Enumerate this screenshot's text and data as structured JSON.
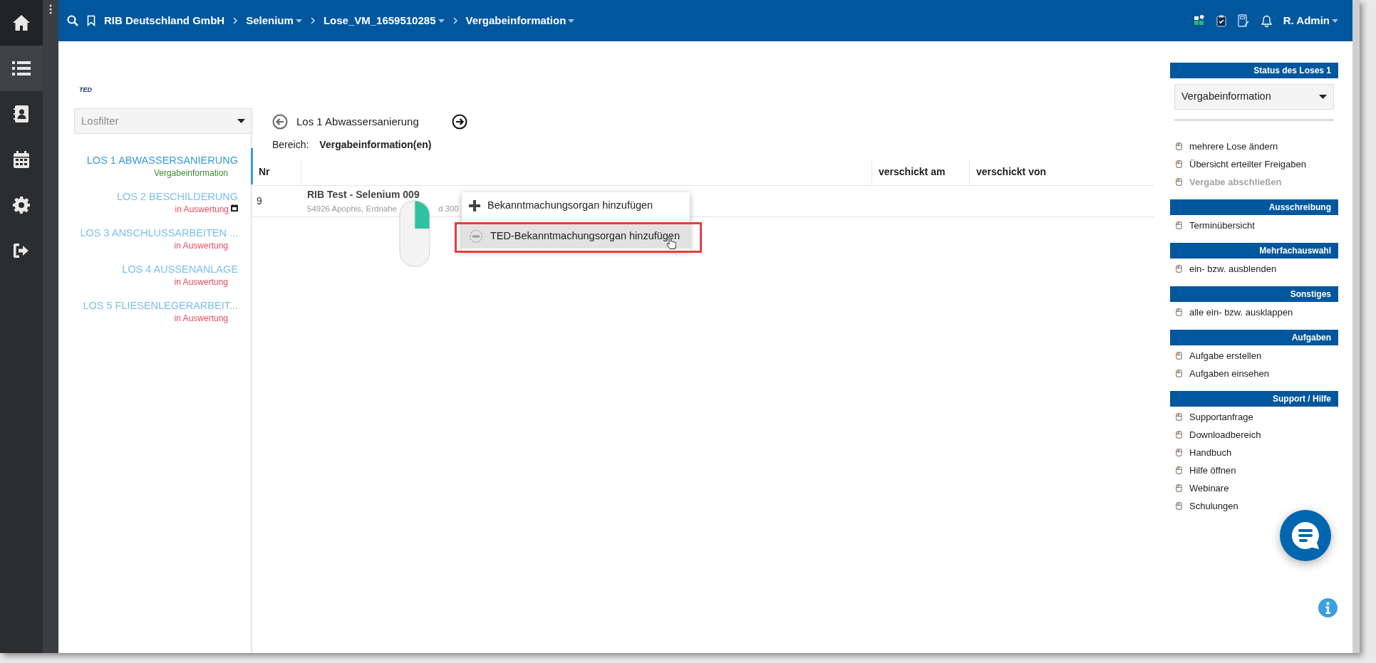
{
  "sidebar": {
    "items": [
      {
        "kind": "home",
        "selected": false
      },
      {
        "kind": "list",
        "selected": true
      },
      {
        "kind": "contacts",
        "selected": false
      },
      {
        "kind": "calendar",
        "selected": false
      },
      {
        "kind": "settings",
        "selected": false
      },
      {
        "kind": "logout",
        "selected": false
      }
    ]
  },
  "breadcrumb": [
    {
      "label": "RIB Deutschland GmbH",
      "dropdown": false
    },
    {
      "label": "Selenium",
      "dropdown": true
    },
    {
      "label": "Lose_VM_1659510285",
      "dropdown": true
    },
    {
      "label": "Vergabeinformation",
      "dropdown": true
    }
  ],
  "header_icons": [
    {
      "kind": "apps"
    },
    {
      "kind": "clipboard"
    },
    {
      "kind": "notebook"
    },
    {
      "kind": "bell"
    }
  ],
  "user": {
    "name": "R. Admin"
  },
  "logo": {
    "text": "TED"
  },
  "lot_filter": {
    "placeholder": "Losfilter"
  },
  "lots": [
    {
      "title": "LOS 1 ABWASSERSANIERUNG",
      "status": "Vergabeinformation",
      "color": "#3c8a2e",
      "selected": true,
      "calendar": false
    },
    {
      "title": "LOS 2 BESCHILDERUNG",
      "status": "in Auswertung",
      "color": "#e84a5f",
      "selected": false,
      "calendar": true
    },
    {
      "title": "LOS 3 ANSCHLUSSARBEITEN ...",
      "status": "in Auswertung",
      "color": "#e84a5f",
      "selected": false,
      "calendar": false
    },
    {
      "title": "LOS 4 AUSSENANLAGE",
      "status": "in Auswertung",
      "color": "#e84a5f",
      "selected": false,
      "calendar": false
    },
    {
      "title": "LOS 5 FLIESENLEGERARBEIT...",
      "status": "in Auswertung",
      "color": "#e84a5f",
      "selected": false,
      "calendar": false
    }
  ],
  "lot_nav": {
    "title": "Los 1 Abwassersanierung"
  },
  "area": {
    "label": "Bereich:",
    "value": "Vergabeinformation(en)"
  },
  "table": {
    "columns": [
      {
        "label": "Nr"
      },
      {},
      {
        "label": "verschickt am"
      },
      {
        "label": "verschickt von"
      }
    ],
    "rows": [
      {
        "nr": "9",
        "title": "RIB Test - Selenium 009",
        "address": [
          "54926 Apophis, Erdnahe",
          "d 300"
        ]
      }
    ]
  },
  "context_menu": {
    "items": [
      {
        "kind": "plus",
        "label": "Bekanntmachungsorgan hinzufügen",
        "selected": false
      },
      {
        "kind": "ted",
        "label": "TED-Bekanntmachungsorgan hinzufügen",
        "selected": true
      }
    ]
  },
  "right_panel": {
    "sections": [
      {
        "title": "Status des Loses 1",
        "select": "Vergabeinformation",
        "items": [
          {
            "label": "mehrere Lose ändern",
            "disabled": false
          },
          {
            "label": "Übersicht erteilter Freigaben",
            "disabled": false
          },
          {
            "label": "Vergabe abschließen",
            "disabled": true
          }
        ]
      },
      {
        "title": "Ausschreibung",
        "items": [
          {
            "label": "Terminübersicht",
            "disabled": false
          }
        ]
      },
      {
        "title": "Mehrfachauswahl",
        "items": [
          {
            "label": "ein- bzw. ausblenden",
            "disabled": false
          }
        ]
      },
      {
        "title": "Sonstiges",
        "items": [
          {
            "label": "alle ein- bzw. ausklappen",
            "disabled": false
          }
        ]
      },
      {
        "title": "Aufgaben",
        "items": [
          {
            "label": "Aufgabe erstellen",
            "disabled": false
          },
          {
            "label": "Aufgaben einsehen",
            "disabled": false
          }
        ]
      },
      {
        "title": "Support / Hilfe",
        "items": [
          {
            "label": "Supportanfrage",
            "disabled": false
          },
          {
            "label": "Downloadbereich",
            "disabled": false
          },
          {
            "label": "Handbuch",
            "disabled": false
          },
          {
            "label": "Hilfe öffnen",
            "disabled": false
          },
          {
            "label": "Webinare",
            "disabled": false
          },
          {
            "label": "Schulungen",
            "disabled": false
          }
        ]
      }
    ]
  }
}
